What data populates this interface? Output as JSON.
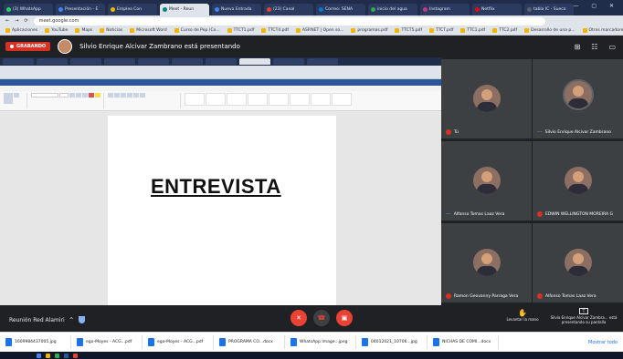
{
  "browser": {
    "tabs": [
      {
        "label": "(3) WhatsApp",
        "color": "#25d366"
      },
      {
        "label": "Presentación - E",
        "color": "#4285f4"
      },
      {
        "label": "Empleo Con",
        "color": "#f4b400"
      },
      {
        "label": "Meet - Reun",
        "color": "#00897b",
        "active": true
      },
      {
        "label": "Nueva Entrada",
        "color": "#4285f4"
      },
      {
        "label": "(23) Canal",
        "color": "#ea4335"
      },
      {
        "label": "Correo: SENA",
        "color": "#0078d4"
      },
      {
        "label": "inicio del agua",
        "color": "#34a853"
      },
      {
        "label": "Instagram",
        "color": "#c13584"
      },
      {
        "label": "Netflix",
        "color": "#e50914"
      },
      {
        "label": "tabla IC - Sueco",
        "color": "#5f6368"
      }
    ],
    "address": "meet.google.com",
    "bookmarks": [
      "Aplicaciones",
      "YouTube",
      "Maps",
      "Noticias",
      "Microsoft Word",
      "Curso de Pep (Co...",
      "TTCT1.pdf",
      "TTCT4.pdf",
      "ASP.NET | Open so...",
      "programas.pdf",
      "TTCT5.pdf",
      "TTCT.pdf",
      "TTC1.pdf",
      "TTC2.pdf",
      "Desarrollo de una p...",
      "Otros marcadores"
    ]
  },
  "meet": {
    "recording_label": "GRABANDO",
    "presenting_text": "Silvio Enrique Alcivar Zambrano está presentando",
    "document_heading": "ENTREVISTA",
    "participants": [
      {
        "name": "Tú",
        "muted": true
      },
      {
        "name": "Silvio Enrique Alcivar Zambrano",
        "muted": false,
        "speaking": true
      },
      {
        "name": "Alfonso Tomas Laaz Vera",
        "muted": false,
        "speaking": true
      },
      {
        "name": "EDWIN WELLINGTON MOREIRA G",
        "muted": true
      },
      {
        "name": "Ramon Geovanny Parraga Vera",
        "muted": true
      },
      {
        "name": "Alfonso Tomas Laaz Vera",
        "muted": true
      }
    ],
    "meeting_name": "Reunión Red Alamiri",
    "lower_hand_label": "Levantar la mano",
    "stop_presenting_label": "Silvio Enrique Alcivar Zambra... está presentando su pantalla"
  },
  "downloads": [
    {
      "name": "1609984437005.jpg"
    },
    {
      "name": "ego-Moyes - ACG...pdf"
    },
    {
      "name": "ego-Moyes - ACG...pdf"
    },
    {
      "name": "PROGRAMA CO...docx"
    },
    {
      "name": "WhatsApp Image...jpeg"
    },
    {
      "name": "04012021_10706...jpg"
    },
    {
      "name": "NICHAS DE COMI...docx"
    }
  ],
  "downloads_show_all": "Mostrar todo",
  "colors": {
    "meet_bg": "#202124",
    "tile_bg": "#3c4043",
    "hangup_red": "#ea4335"
  }
}
